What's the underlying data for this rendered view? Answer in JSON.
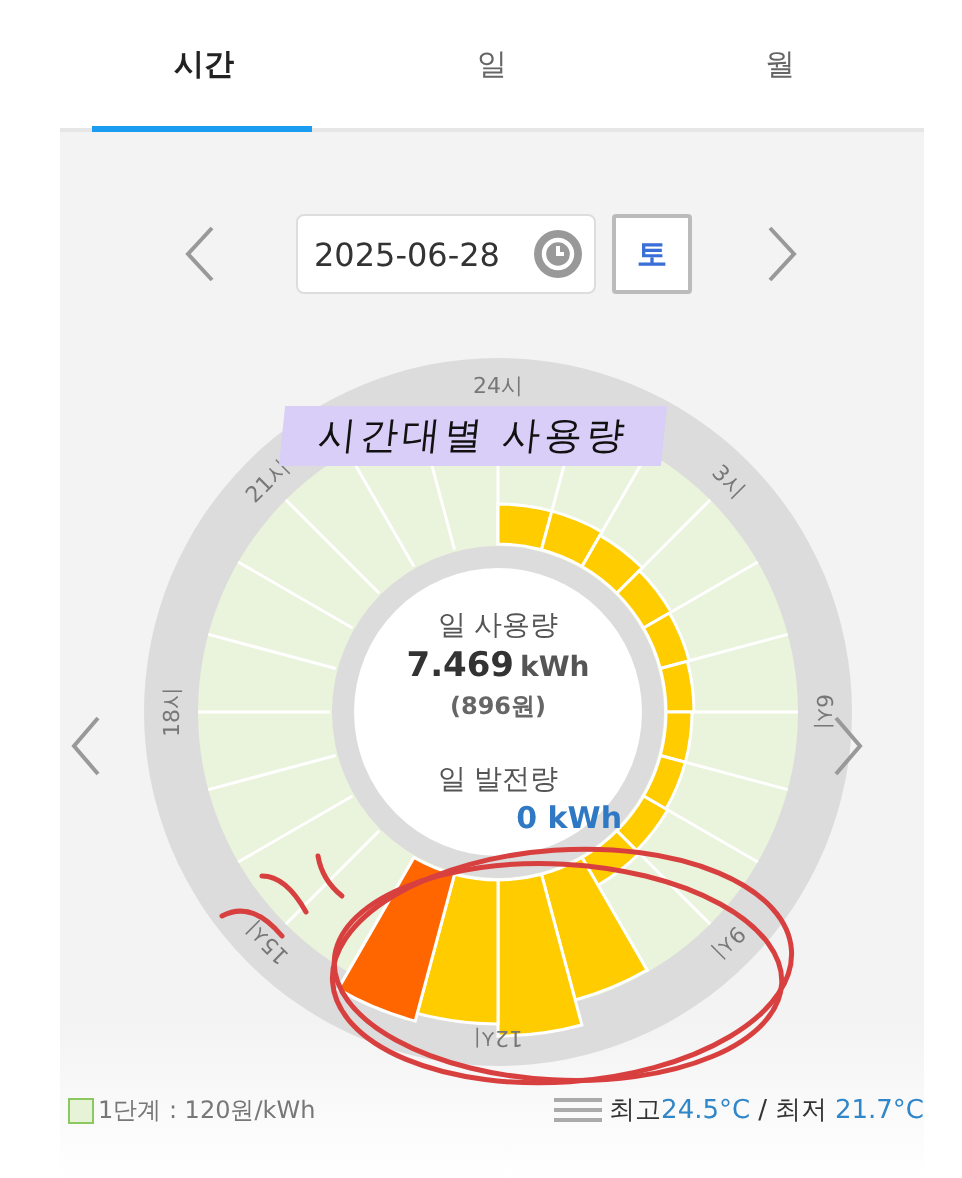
{
  "tabs": [
    {
      "label": "시간",
      "selected": true
    },
    {
      "label": "일",
      "selected": false
    },
    {
      "label": "월",
      "selected": false
    }
  ],
  "date_picker": {
    "date": "2025-06-28",
    "weekday": "토"
  },
  "usage_chart": {
    "annotation": "시간대별 사용량",
    "hour_labels": [
      "24시",
      "3시",
      "6시",
      "9시",
      "12시",
      "15시",
      "18시",
      "21시"
    ],
    "daily_usage_label": "일 사용량",
    "daily_usage_value": "7.469",
    "daily_usage_unit": "kWh",
    "daily_cost": "(896원)",
    "daily_generation_label": "일 발전량",
    "daily_generation_value": "0 kWh"
  },
  "legend": {
    "tier": "1단계 : 120원/kWh"
  },
  "weather": {
    "high_label": "최고",
    "high": "24.5°C",
    "separator": "/",
    "low_label": "최저",
    "low": "21.7°C"
  }
}
